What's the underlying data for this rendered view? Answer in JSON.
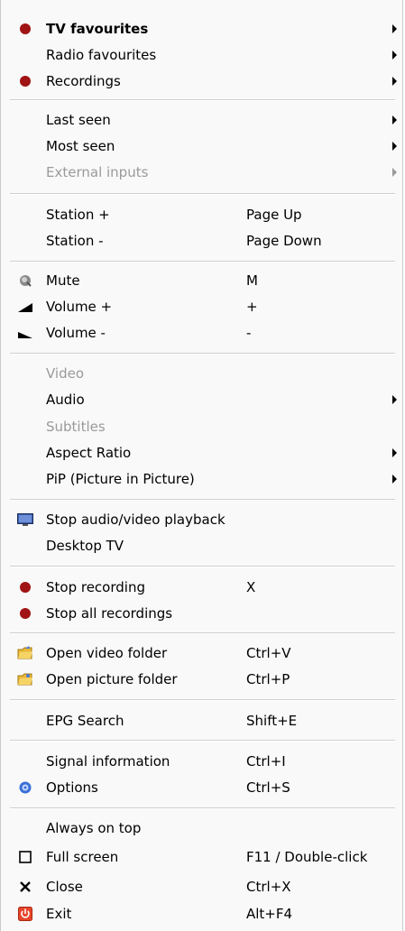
{
  "menu": {
    "tv_favourites": "TV favourites",
    "radio_favourites": "Radio favourites",
    "recordings": "Recordings",
    "last_seen": "Last seen",
    "most_seen": "Most seen",
    "external_inputs": "External inputs",
    "station_plus": "Station +",
    "station_plus_shortcut": "Page Up",
    "station_minus": "Station -",
    "station_minus_shortcut": "Page Down",
    "mute": "Mute",
    "mute_shortcut": "M",
    "volume_up": "Volume +",
    "volume_up_shortcut": "+",
    "volume_down": "Volume -",
    "volume_down_shortcut": "-",
    "video": "Video",
    "audio": "Audio",
    "subtitles": "Subtitles",
    "aspect_ratio": "Aspect Ratio",
    "pip": "PiP (Picture in Picture)",
    "stop_playback": "Stop audio/video playback",
    "desktop_tv": "Desktop TV",
    "stop_recording": "Stop recording",
    "stop_recording_shortcut": "X",
    "stop_all_recordings": "Stop all recordings",
    "open_video_folder": "Open video folder",
    "open_video_folder_shortcut": "Ctrl+V",
    "open_picture_folder": "Open picture folder",
    "open_picture_folder_shortcut": "Ctrl+P",
    "epg_search": "EPG Search",
    "epg_search_shortcut": "Shift+E",
    "signal_information": "Signal information",
    "signal_information_shortcut": "Ctrl+I",
    "options": "Options",
    "options_shortcut": "Ctrl+S",
    "always_on_top": "Always on top",
    "full_screen": "Full screen",
    "full_screen_shortcut": "F11 / Double-click",
    "close": "Close",
    "close_shortcut": "Ctrl+X",
    "exit": "Exit",
    "exit_shortcut": "Alt+F4"
  },
  "colors": {
    "record_red": "#a01414",
    "disabled_text": "#9a9a9a",
    "exit_icon": "#e8452c",
    "folder_yellow": "#f0c040",
    "options_blue": "#3a6fd8"
  }
}
